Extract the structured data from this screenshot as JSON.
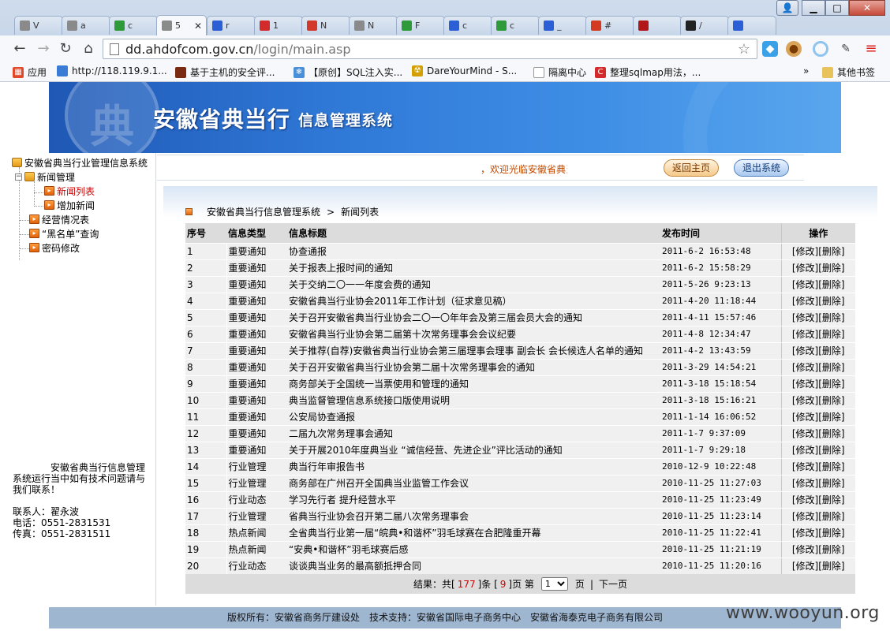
{
  "browser": {
    "tabs": [
      {
        "label": "V",
        "color": "#8a8a8a"
      },
      {
        "label": "a",
        "color": "#8a8a8a"
      },
      {
        "label": "c",
        "color": "#2f9a3a"
      },
      {
        "label": "5",
        "color": "#8a8a8a",
        "active": true
      },
      {
        "label": "r",
        "color": "#2b5fd6"
      },
      {
        "label": "1",
        "color": "#d32b2b"
      },
      {
        "label": "N",
        "color": "#d3392b"
      },
      {
        "label": "N",
        "color": "#8a8a8a"
      },
      {
        "label": "F",
        "color": "#2f9a3a"
      },
      {
        "label": "c",
        "color": "#2b5fd6"
      },
      {
        "label": "c",
        "color": "#2f9a3a"
      },
      {
        "label": "_",
        "color": "#2b5fd6"
      },
      {
        "label": "#",
        "color": "#d33a1f"
      },
      {
        "label": "",
        "color": "#b01818"
      },
      {
        "label": "/",
        "color": "#222222"
      },
      {
        "label": "",
        "color": "#2b5fd6"
      }
    ],
    "address": {
      "host": "dd.ahdofcom.gov.cn",
      "path": "/login/main.asp"
    },
    "bookmarks": [
      {
        "label": "应用",
        "icon": "apps-icon",
        "color": "#e04a2a"
      },
      {
        "label": "http://118.119.9.1...",
        "icon": "page-icon",
        "color": "#3a7bd5"
      },
      {
        "label": "基于主机的安全评...",
        "icon": "doc-icon",
        "color": "#7a2a10"
      },
      {
        "label": "【原创】SQL注入实...",
        "icon": "snowflake-icon",
        "color": "#4a90d9"
      },
      {
        "label": "DareYourMind - S...",
        "icon": "radiation-icon",
        "color": "#d4a000"
      },
      {
        "label": "隔离中心",
        "icon": "page-icon",
        "color": "#9a9a9a"
      },
      {
        "label": "整理sqlmap用法，...",
        "icon": "c-icon",
        "color": "#d32b2b"
      }
    ],
    "bookmarks_more": "»",
    "other_bookmarks": "其他书签"
  },
  "header": {
    "title_main": "安徽省典当行",
    "title_sub": "信息管理系统",
    "seal_char": "典",
    "welcome": "，欢迎光临安徽省典当",
    "home_button": "返回主页",
    "exit_button": "退出系统"
  },
  "tree": {
    "root": "安徽省典当行业管理信息系统",
    "news_mgmt": "新闻管理",
    "news_list": "新闻列表",
    "add_news": "增加新闻",
    "business": "经营情况表",
    "blacklist": "“黑名单”查询",
    "password": "密码修改"
  },
  "contact": {
    "notice": "安徽省典当行信息管理系统运行当中如有技术问题请与我们联系！",
    "person": "联系人：翟永波",
    "phone": "电话：0551-2831531",
    "fax": "传真：0551-2831511"
  },
  "breadcrumb": {
    "system": "安徽省典当行信息管理系统",
    "sep": ">",
    "page": "新闻列表"
  },
  "table": {
    "headers": [
      "序号",
      "信息类型",
      "信息标题",
      "发布时间",
      "操作"
    ],
    "edit_label": "[修改]",
    "delete_label": "[删除]",
    "rows": [
      [
        "1",
        "重要通知",
        "协查通报",
        "2011-6-2 16:53:48"
      ],
      [
        "2",
        "重要通知",
        "关于报表上报时间的通知",
        "2011-6-2 15:58:29"
      ],
      [
        "3",
        "重要通知",
        "关于交纳二〇一一年度会费的通知",
        "2011-5-26 9:23:13"
      ],
      [
        "4",
        "重要通知",
        "安徽省典当行业协会2011年工作计划（征求意见稿）",
        "2011-4-20 11:18:44"
      ],
      [
        "5",
        "重要通知",
        "关于召开安徽省典当行业协会二〇一〇年年会及第三届会员大会的通知",
        "2011-4-11 15:57:46"
      ],
      [
        "6",
        "重要通知",
        "安徽省典当行业协会第二届第十次常务理事会会议纪要",
        "2011-4-8 12:34:47"
      ],
      [
        "7",
        "重要通知",
        "关于推荐(自荐)安徽省典当行业协会第三届理事会理事 副会长 会长候选人名单的通知",
        "2011-4-2 13:43:59"
      ],
      [
        "8",
        "重要通知",
        "关于召开安徽省典当行业协会第二届十次常务理事会的通知",
        "2011-3-29 14:54:21"
      ],
      [
        "9",
        "重要通知",
        "商务部关于全国统一当票使用和管理的通知",
        "2011-3-18 15:18:54"
      ],
      [
        "10",
        "重要通知",
        "典当监督管理信息系统接口版使用说明",
        "2011-3-18 15:16:21"
      ],
      [
        "11",
        "重要通知",
        "公安局协查通报",
        "2011-1-14 16:06:52"
      ],
      [
        "12",
        "重要通知",
        "二届九次常务理事会通知",
        "2011-1-7 9:37:09"
      ],
      [
        "13",
        "重要通知",
        "关于开展2010年度典当业 “诚信经营、先进企业”评比活动的通知",
        "2011-1-7 9:29:18"
      ],
      [
        "14",
        "行业管理",
        "典当行年审报告书",
        "2010-12-9 10:22:48"
      ],
      [
        "15",
        "行业管理",
        "商务部在广州召开全国典当业监管工作会议",
        "2010-11-25 11:27:03"
      ],
      [
        "16",
        "行业动态",
        "学习先行者 提升经营水平",
        "2010-11-25 11:23:49"
      ],
      [
        "17",
        "行业管理",
        "省典当行业协会召开第二届八次常务理事会",
        "2010-11-25 11:23:14"
      ],
      [
        "18",
        "热点新闻",
        "全省典当行业第一届“皖典•和谐杯”羽毛球赛在合肥隆重开幕",
        "2010-11-25 11:22:41"
      ],
      [
        "19",
        "热点新闻",
        "“安典•和谐杯”羽毛球赛后感",
        "2010-11-25 11:21:19"
      ],
      [
        "20",
        "行业动态",
        "谈谈典当业务的最高额抵押合同",
        "2010-11-25 11:20:16"
      ]
    ]
  },
  "pager": {
    "result_prefix": "结果：共[",
    "total": "177",
    "result_mid": "]条 [",
    "pages": "9",
    "result_suffix": "]页 第",
    "current": "1",
    "page_word": "页",
    "divider": "|",
    "next": "下一页"
  },
  "footer": "版权所有：安徽省商务厅建设处　技术支持：安徽省国际电子商务中心　安徽省海泰克电子商务有限公司",
  "watermark": "www.wooyun.org",
  "colors": {
    "banner": "#2f78d6",
    "accent_red": "#d10000",
    "table_header": "#dcdcdc",
    "row": "#f0f0f0"
  }
}
